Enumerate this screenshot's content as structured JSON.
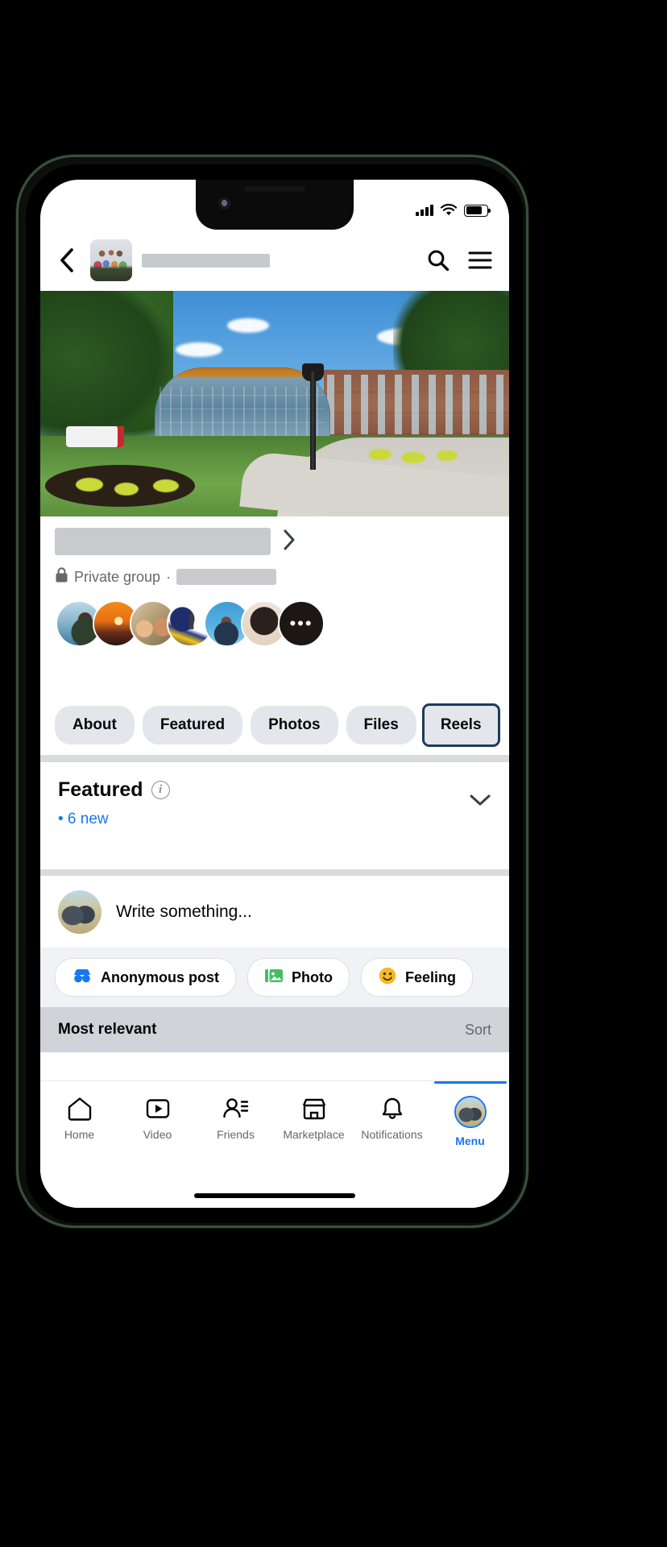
{
  "device": {
    "frame_color": "#39503c",
    "status_bar": {
      "signal_icon": "cellular-signal-icon",
      "wifi_icon": "wifi-icon",
      "battery_icon": "battery-icon"
    }
  },
  "header": {
    "back_icon": "chevron-left-icon",
    "group_avatar": "group-avatar-image",
    "title_redacted": true,
    "search_icon": "search-icon",
    "menu_icon": "hamburger-menu-icon"
  },
  "cover": {
    "image_description": "campus-building-cover-photo"
  },
  "group": {
    "name_redacted": true,
    "chevron_icon": "chevron-right-icon",
    "privacy_icon": "lock-icon",
    "privacy_label": "Private group",
    "separator": "·",
    "member_count_redacted": true,
    "members": [
      {
        "name": "member-avatar-1"
      },
      {
        "name": "member-avatar-2"
      },
      {
        "name": "member-avatar-3"
      },
      {
        "name": "member-avatar-4"
      },
      {
        "name": "member-avatar-5"
      },
      {
        "name": "member-avatar-6"
      }
    ],
    "more_members_label": "•••"
  },
  "tabs": [
    {
      "label": "About",
      "focused": false
    },
    {
      "label": "Featured",
      "focused": false
    },
    {
      "label": "Photos",
      "focused": false
    },
    {
      "label": "Files",
      "focused": false
    },
    {
      "label": "Reels",
      "focused": true
    }
  ],
  "featured": {
    "title": "Featured",
    "info_icon": "info-icon",
    "new_label": "• 6 new",
    "collapse_icon": "chevron-down-icon"
  },
  "composer": {
    "avatar": "user-avatar-image",
    "placeholder": "Write something...",
    "actions": [
      {
        "label": "Anonymous post",
        "icon": "incognito-mask-icon",
        "color": "#1877f2"
      },
      {
        "label": "Photo",
        "icon": "photo-icon",
        "color": "#45bd62"
      },
      {
        "label": "Feeling",
        "icon": "smiley-icon",
        "color": "#f7b928"
      }
    ]
  },
  "sort": {
    "current": "Most relevant",
    "action_label": "Sort"
  },
  "bottom_nav": [
    {
      "label": "Home",
      "icon": "home-icon",
      "active": false
    },
    {
      "label": "Video",
      "icon": "video-icon",
      "active": false
    },
    {
      "label": "Friends",
      "icon": "friends-icon",
      "active": false
    },
    {
      "label": "Marketplace",
      "icon": "marketplace-icon",
      "active": false
    },
    {
      "label": "Notifications",
      "icon": "bell-icon",
      "active": false
    },
    {
      "label": "Menu",
      "icon": "profile-avatar-icon",
      "active": true
    }
  ],
  "colors": {
    "accent": "#1877f2",
    "chip_bg": "#e4e6eb",
    "divider": "#d9dbde",
    "sort_bar": "#d0d3d8",
    "muted_text": "#65676b",
    "focus_ring": "#1c3b5a"
  }
}
